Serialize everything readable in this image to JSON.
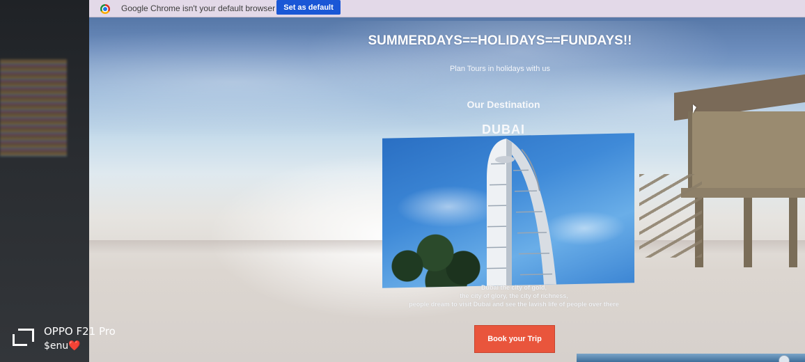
{
  "infobar": {
    "message": "Google Chrome isn't your default browser",
    "button_label": "Set as default"
  },
  "page": {
    "headline": "SUMMERDAYS==HOLIDAYS==FUNDAYS!!",
    "tagline": "Plan Tours in holidays with us",
    "destination_heading": "Our Destination",
    "city_name": "DUBAI",
    "city_description": [
      "Dubai the city of gold,",
      "the city of glory, the city of richness,",
      "people dream to visit Dubai and see the lavish life of people over there"
    ],
    "cta_label": "Book your Trip"
  },
  "watermark": {
    "device": "OPPO F21 Pro",
    "user": "$enu❤️"
  },
  "colors": {
    "cta_background": "#e9553c",
    "set_default_button": "#1a57d6",
    "infobar_background": "#e3d9e8"
  }
}
